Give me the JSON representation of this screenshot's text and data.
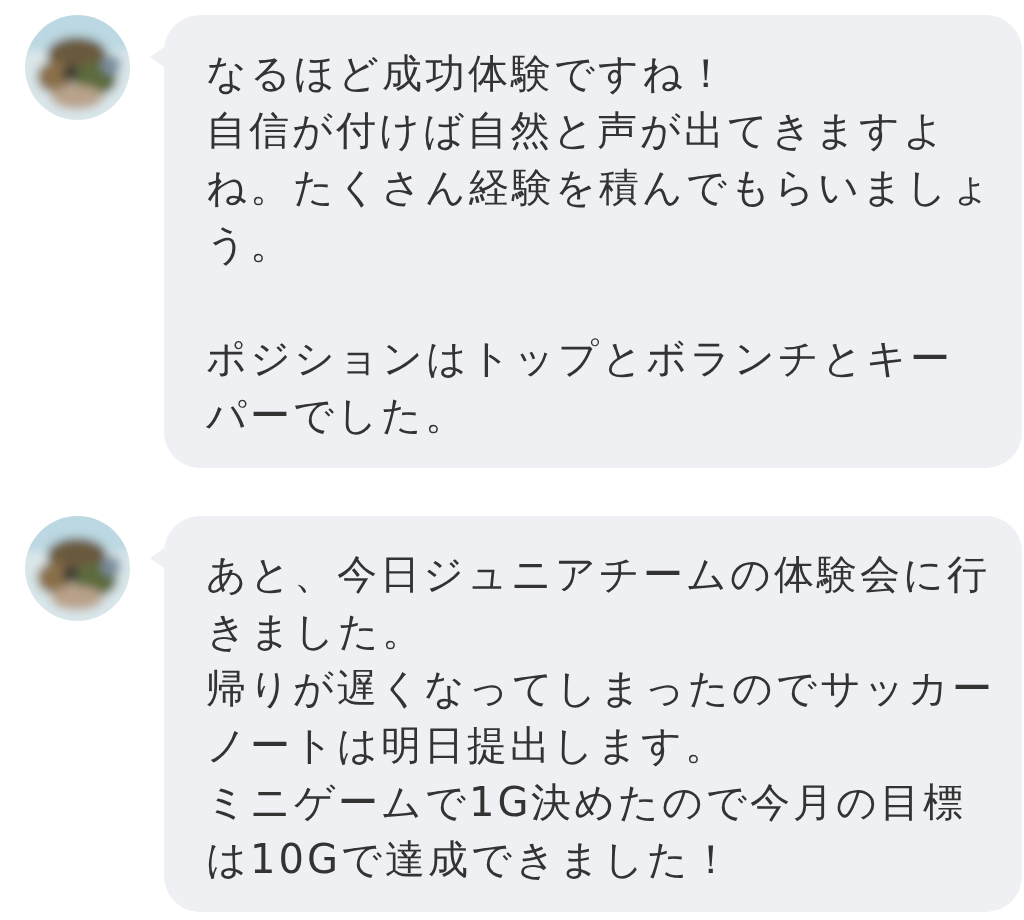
{
  "messages": [
    {
      "blocks": [
        {
          "lines": [
            "なるほど成功体験ですね！",
            "自信が付けば自然と声が出てきますよね。たくさん経験を積んでもらいましょう。"
          ]
        },
        {
          "lines": [
            "ポジションはトップとボランチとキーパーでした。"
          ]
        }
      ]
    },
    {
      "blocks": [
        {
          "lines": [
            "あと、今日ジュニアチームの体験会に行きました。",
            "帰りが遅くなってしまったのでサッカーノートは明日提出します。",
            "ミニゲームで1G決めたので今月の目標は10Gで達成できました！"
          ]
        }
      ]
    }
  ]
}
